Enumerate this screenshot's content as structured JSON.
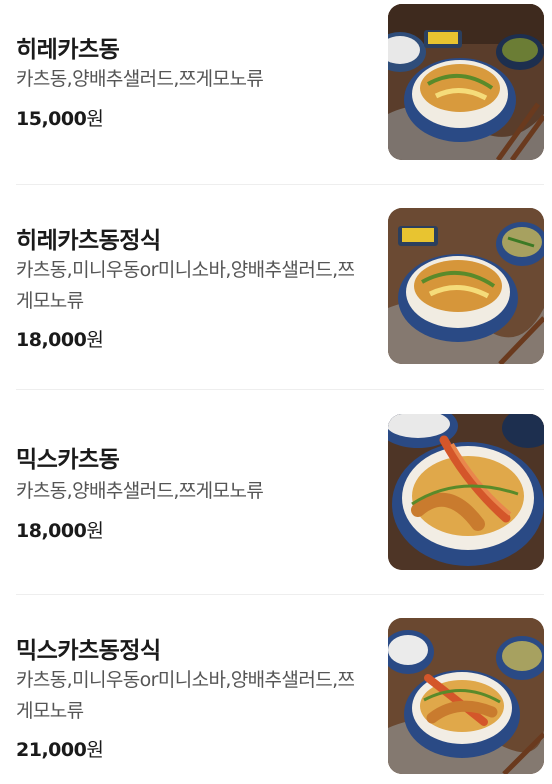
{
  "menu": {
    "items": [
      {
        "name": "히레카츠동",
        "description": "카츠동,양배추샐러드,쯔게모노류",
        "price_number": "15,000",
        "price_unit": "원",
        "photo_icon": "katsudon-photo"
      },
      {
        "name": "히레카츠동정식",
        "description": "카츠동,미니우동or미니소바,양배추샐러드,쯔게모노류",
        "price_number": "18,000",
        "price_unit": "원",
        "photo_icon": "katsudon-set-photo"
      },
      {
        "name": "믹스카츠동",
        "description": "카츠동,양배추샐러드,쯔게모노류",
        "price_number": "18,000",
        "price_unit": "원",
        "photo_icon": "mix-katsudon-photo"
      },
      {
        "name": "믹스카츠동정식",
        "description": "카츠동,미니우동or미니소바,양배추샐러드,쯔게모노류",
        "price_number": "21,000",
        "price_unit": "원",
        "photo_icon": "mix-katsudon-set-photo"
      }
    ]
  }
}
